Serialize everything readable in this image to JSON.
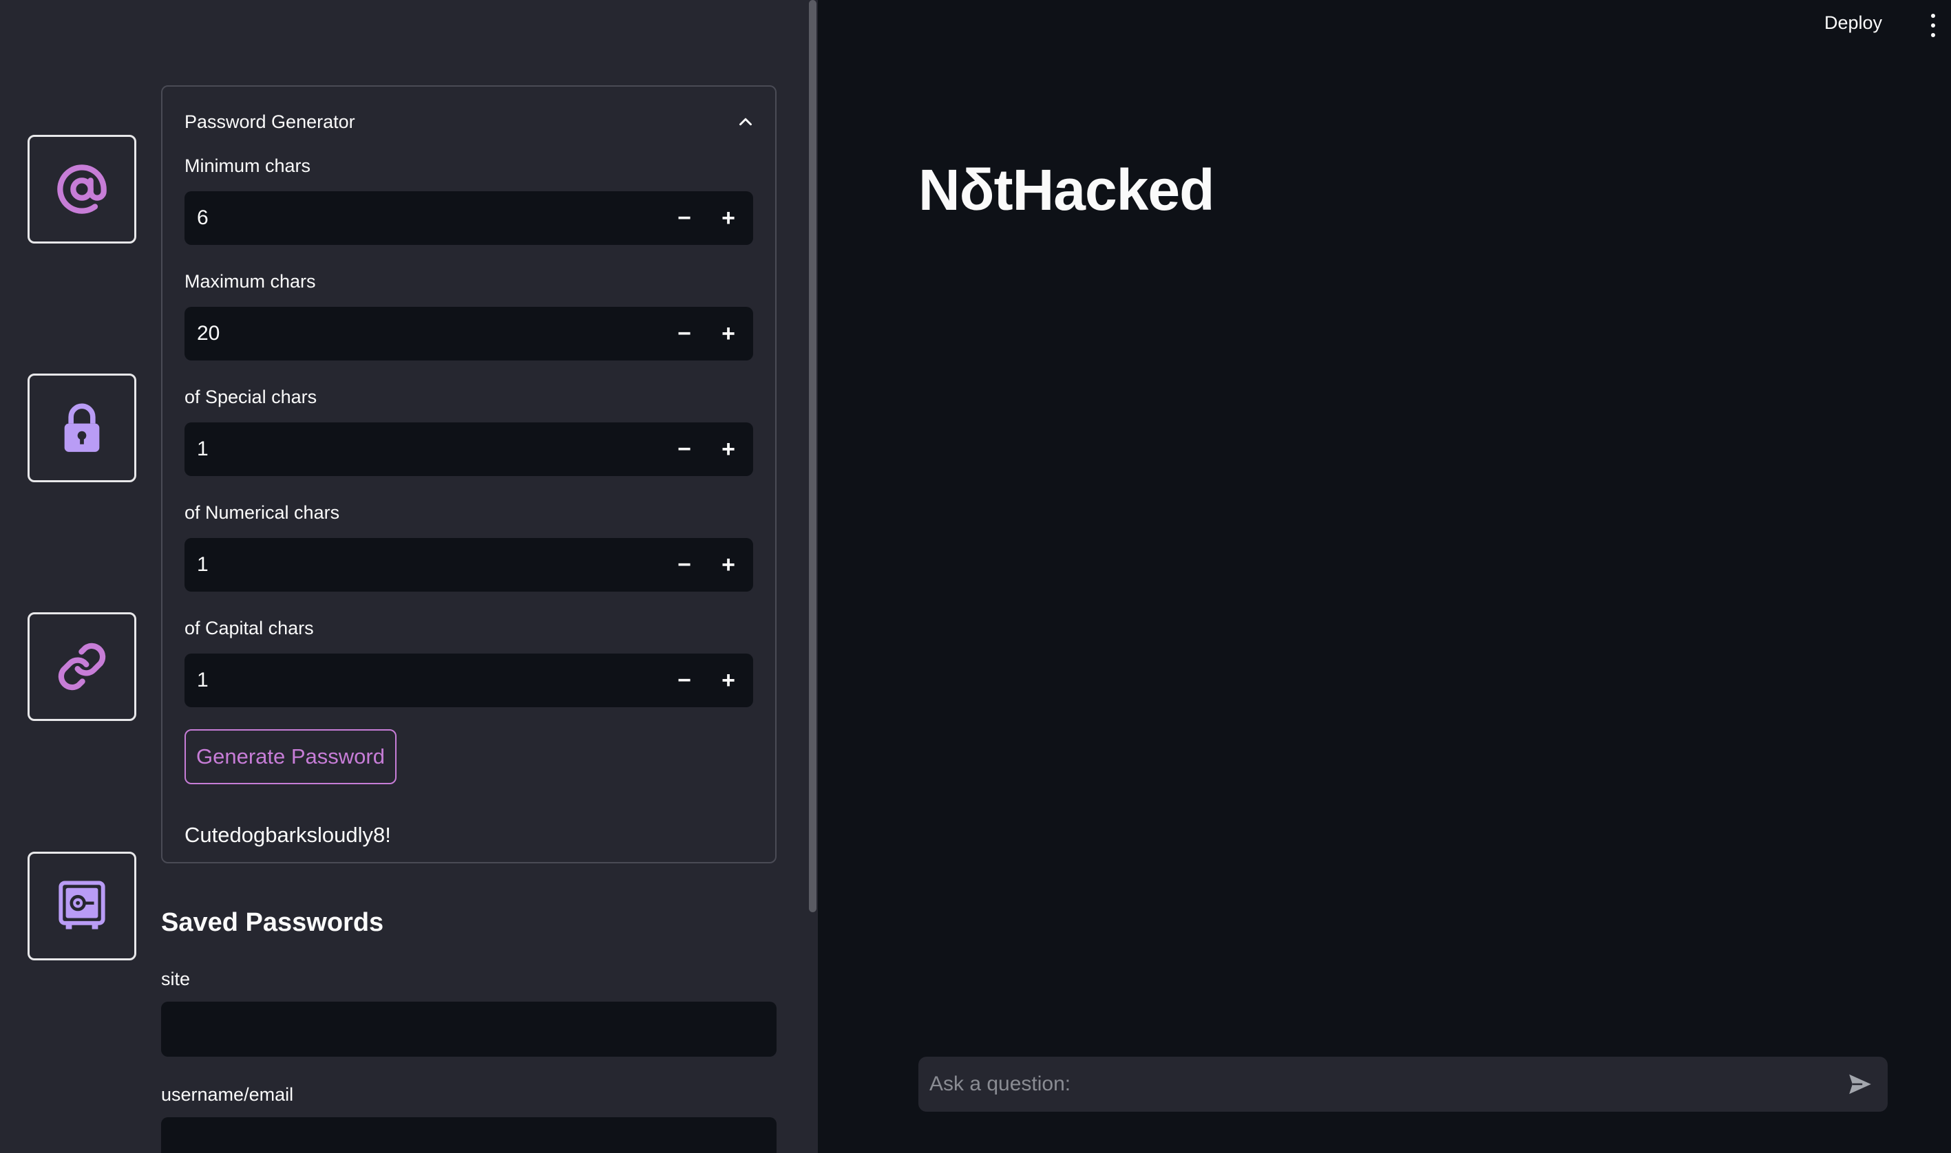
{
  "sidebar": {
    "nav_icons": [
      "at-sign-icon",
      "lock-icon",
      "link-icon",
      "vault-icon"
    ],
    "accent_color": "#c77dd7",
    "icon_color": "#b99cf5",
    "generator": {
      "title": "Password Generator",
      "fields": [
        {
          "label": "Minimum chars",
          "value": "6"
        },
        {
          "label": "Maximum chars",
          "value": "20"
        },
        {
          "label": "of Special chars",
          "value": "1"
        },
        {
          "label": "of Numerical chars",
          "value": "1"
        },
        {
          "label": "of Capital chars",
          "value": "1"
        }
      ],
      "stepper_minus": "−",
      "stepper_plus": "+",
      "button_label": "Generate Password",
      "generated_password": "Cutedogbarksloudly8!"
    },
    "saved": {
      "title": "Saved Passwords",
      "site_label": "site",
      "site_value": "",
      "username_label": "username/email",
      "username_value": ""
    }
  },
  "header": {
    "deploy_label": "Deploy"
  },
  "main": {
    "title": "NδtHacked",
    "chat_placeholder": "Ask a question:"
  }
}
